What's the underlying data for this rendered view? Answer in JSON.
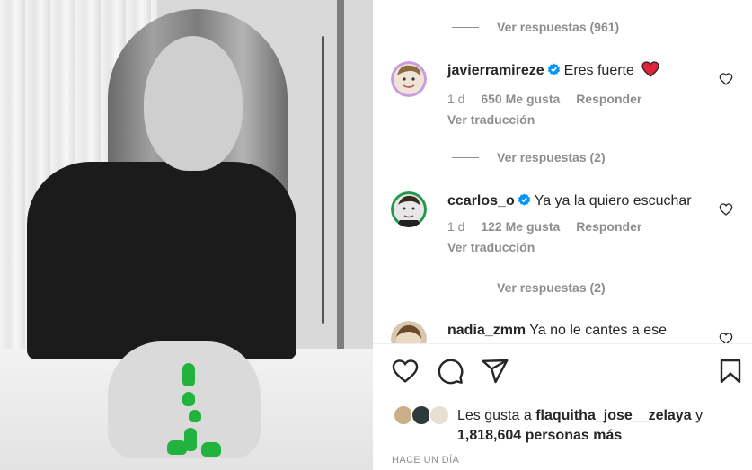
{
  "post": {
    "media_alt": "",
    "timeago": "HACE UN DÍA"
  },
  "comments": {
    "top_replies": "Ver respuestas (961)",
    "items": [
      {
        "username": "javierramireze",
        "verified": true,
        "text": "Eres fuerte",
        "emoji": "❤️",
        "time": "1 d",
        "likes": "650 Me gusta",
        "reply": "Responder",
        "translate": "Ver traducción",
        "replies": "Ver respuestas (2)"
      },
      {
        "username": "ccarlos_o",
        "verified": true,
        "text": "Ya ya la quiero escuchar",
        "time": "1 d",
        "likes": "122 Me gusta",
        "reply": "Responder",
        "translate": "Ver traducción",
        "replies": "Ver respuestas (2)"
      },
      {
        "username": "nadia_zmm",
        "verified": false,
        "text": "Ya no le cantes a ese"
      }
    ]
  },
  "actions": {
    "like_icon": "heart-outline-icon",
    "comment_icon": "comment-icon",
    "share_icon": "paper-plane-icon",
    "save_icon": "bookmark-icon"
  },
  "likes": {
    "prefix": "Les gusta a",
    "user": "flaquitha_jose__zelaya",
    "conj": "y",
    "count": "1,818,604 personas más"
  },
  "colors": {
    "verified": "#0095f6",
    "heart_red": "#ed4956",
    "muted": "#8e8e8e",
    "nail_green": "#21b33d"
  }
}
